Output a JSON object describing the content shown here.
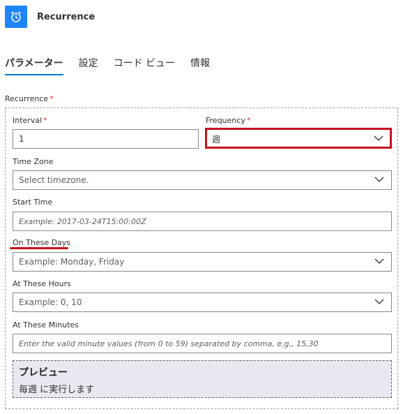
{
  "header": {
    "title": "Recurrence",
    "icon": "alarm-clock-icon",
    "accent": "#1f85ff"
  },
  "tabs": [
    {
      "label": "パラメーター",
      "active": true
    },
    {
      "label": "設定",
      "active": false
    },
    {
      "label": "コード ビュー",
      "active": false
    },
    {
      "label": "情報",
      "active": false
    }
  ],
  "form": {
    "section_label": "Recurrence",
    "required_mark": "*",
    "interval": {
      "label": "Interval",
      "value": "1"
    },
    "frequency": {
      "label": "Frequency",
      "value": "週"
    },
    "timezone": {
      "label": "Time Zone",
      "placeholder": "Select timezone."
    },
    "start_time": {
      "label": "Start Time",
      "placeholder": "Example: 2017-03-24T15:00:00Z"
    },
    "days": {
      "label": "On These Days",
      "placeholder": "Example: Monday, Friday"
    },
    "hours": {
      "label": "At These Hours",
      "placeholder": "Example: 0, 10"
    },
    "minutes": {
      "label": "At These Minutes",
      "placeholder": "Enter the valid minute values (from 0 to 59) separated by comma, e.g., 15,30"
    }
  },
  "preview": {
    "title": "プレビュー",
    "text": "毎週 に実行します"
  },
  "annotation_color": "#c50f1f"
}
